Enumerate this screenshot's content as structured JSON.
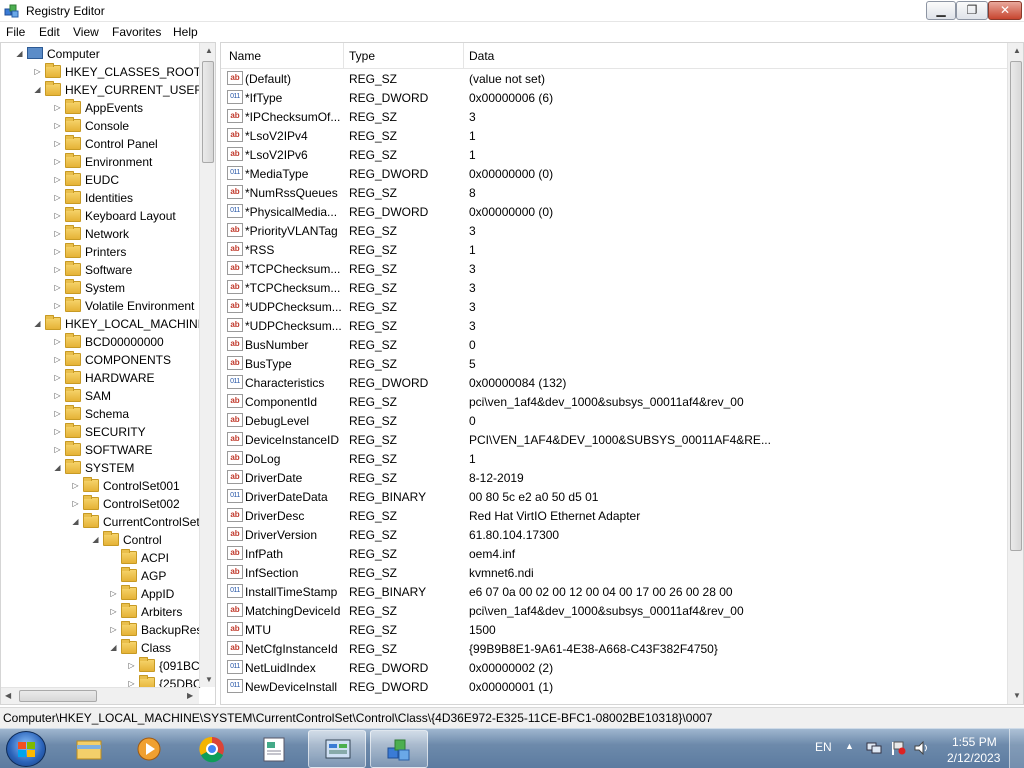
{
  "window": {
    "title": "Registry Editor",
    "min_label": "▁",
    "max_label": "❐",
    "close_label": "✕"
  },
  "menu": [
    "File",
    "Edit",
    "View",
    "Favorites",
    "Help"
  ],
  "tree": [
    {
      "label": "Computer",
      "level": 0,
      "state": "open",
      "icon": "computer-icon"
    },
    {
      "label": "HKEY_CLASSES_ROOT",
      "level": 1,
      "state": "closed"
    },
    {
      "label": "HKEY_CURRENT_USER",
      "level": 1,
      "state": "open"
    },
    {
      "label": "AppEvents",
      "level": 2,
      "state": "closed"
    },
    {
      "label": "Console",
      "level": 2,
      "state": "closed"
    },
    {
      "label": "Control Panel",
      "level": 2,
      "state": "closed"
    },
    {
      "label": "Environment",
      "level": 2,
      "state": "closed"
    },
    {
      "label": "EUDC",
      "level": 2,
      "state": "closed"
    },
    {
      "label": "Identities",
      "level": 2,
      "state": "closed"
    },
    {
      "label": "Keyboard Layout",
      "level": 2,
      "state": "closed"
    },
    {
      "label": "Network",
      "level": 2,
      "state": "closed"
    },
    {
      "label": "Printers",
      "level": 2,
      "state": "closed"
    },
    {
      "label": "Software",
      "level": 2,
      "state": "closed"
    },
    {
      "label": "System",
      "level": 2,
      "state": "closed"
    },
    {
      "label": "Volatile Environment",
      "level": 2,
      "state": "closed"
    },
    {
      "label": "HKEY_LOCAL_MACHINE",
      "level": 1,
      "state": "open"
    },
    {
      "label": "BCD00000000",
      "level": 2,
      "state": "closed"
    },
    {
      "label": "COMPONENTS",
      "level": 2,
      "state": "closed"
    },
    {
      "label": "HARDWARE",
      "level": 2,
      "state": "closed"
    },
    {
      "label": "SAM",
      "level": 2,
      "state": "closed"
    },
    {
      "label": "Schema",
      "level": 2,
      "state": "closed"
    },
    {
      "label": "SECURITY",
      "level": 2,
      "state": "closed"
    },
    {
      "label": "SOFTWARE",
      "level": 2,
      "state": "closed"
    },
    {
      "label": "SYSTEM",
      "level": 2,
      "state": "open"
    },
    {
      "label": "ControlSet001",
      "level": 3,
      "state": "closed"
    },
    {
      "label": "ControlSet002",
      "level": 3,
      "state": "closed"
    },
    {
      "label": "CurrentControlSet",
      "level": 3,
      "state": "open"
    },
    {
      "label": "Control",
      "level": 4,
      "state": "open"
    },
    {
      "label": "ACPI",
      "level": 5,
      "state": "none"
    },
    {
      "label": "AGP",
      "level": 5,
      "state": "none"
    },
    {
      "label": "AppID",
      "level": 5,
      "state": "closed"
    },
    {
      "label": "Arbiters",
      "level": 5,
      "state": "closed"
    },
    {
      "label": "BackupRes",
      "level": 5,
      "state": "closed"
    },
    {
      "label": "Class",
      "level": 5,
      "state": "open"
    },
    {
      "label": "{091BC",
      "level": 6,
      "state": "closed"
    },
    {
      "label": "{25DBC",
      "level": 6,
      "state": "closed"
    }
  ],
  "columns": {
    "name": "Name",
    "type": "Type",
    "data": "Data"
  },
  "values": [
    {
      "icon": "ab",
      "name": "(Default)",
      "type": "REG_SZ",
      "data": "(value not set)"
    },
    {
      "icon": "bin",
      "name": "*IfType",
      "type": "REG_DWORD",
      "data": "0x00000006 (6)"
    },
    {
      "icon": "ab",
      "name": "*IPChecksumOf...",
      "type": "REG_SZ",
      "data": "3"
    },
    {
      "icon": "ab",
      "name": "*LsoV2IPv4",
      "type": "REG_SZ",
      "data": "1"
    },
    {
      "icon": "ab",
      "name": "*LsoV2IPv6",
      "type": "REG_SZ",
      "data": "1"
    },
    {
      "icon": "bin",
      "name": "*MediaType",
      "type": "REG_DWORD",
      "data": "0x00000000 (0)"
    },
    {
      "icon": "ab",
      "name": "*NumRssQueues",
      "type": "REG_SZ",
      "data": "8"
    },
    {
      "icon": "bin",
      "name": "*PhysicalMedia...",
      "type": "REG_DWORD",
      "data": "0x00000000 (0)"
    },
    {
      "icon": "ab",
      "name": "*PriorityVLANTag",
      "type": "REG_SZ",
      "data": "3"
    },
    {
      "icon": "ab",
      "name": "*RSS",
      "type": "REG_SZ",
      "data": "1"
    },
    {
      "icon": "ab",
      "name": "*TCPChecksum...",
      "type": "REG_SZ",
      "data": "3"
    },
    {
      "icon": "ab",
      "name": "*TCPChecksum...",
      "type": "REG_SZ",
      "data": "3"
    },
    {
      "icon": "ab",
      "name": "*UDPChecksum...",
      "type": "REG_SZ",
      "data": "3"
    },
    {
      "icon": "ab",
      "name": "*UDPChecksum...",
      "type": "REG_SZ",
      "data": "3"
    },
    {
      "icon": "ab",
      "name": "BusNumber",
      "type": "REG_SZ",
      "data": "0"
    },
    {
      "icon": "ab",
      "name": "BusType",
      "type": "REG_SZ",
      "data": "5"
    },
    {
      "icon": "bin",
      "name": "Characteristics",
      "type": "REG_DWORD",
      "data": "0x00000084 (132)"
    },
    {
      "icon": "ab",
      "name": "ComponentId",
      "type": "REG_SZ",
      "data": "pci\\ven_1af4&dev_1000&subsys_00011af4&rev_00"
    },
    {
      "icon": "ab",
      "name": "DebugLevel",
      "type": "REG_SZ",
      "data": "0"
    },
    {
      "icon": "ab",
      "name": "DeviceInstanceID",
      "type": "REG_SZ",
      "data": "PCI\\VEN_1AF4&DEV_1000&SUBSYS_00011AF4&RE..."
    },
    {
      "icon": "ab",
      "name": "DoLog",
      "type": "REG_SZ",
      "data": "1"
    },
    {
      "icon": "ab",
      "name": "DriverDate",
      "type": "REG_SZ",
      "data": "8-12-2019"
    },
    {
      "icon": "bin",
      "name": "DriverDateData",
      "type": "REG_BINARY",
      "data": "00 80 5c e2 a0 50 d5 01"
    },
    {
      "icon": "ab",
      "name": "DriverDesc",
      "type": "REG_SZ",
      "data": "Red Hat VirtIO Ethernet Adapter"
    },
    {
      "icon": "ab",
      "name": "DriverVersion",
      "type": "REG_SZ",
      "data": "61.80.104.17300"
    },
    {
      "icon": "ab",
      "name": "InfPath",
      "type": "REG_SZ",
      "data": "oem4.inf"
    },
    {
      "icon": "ab",
      "name": "InfSection",
      "type": "REG_SZ",
      "data": "kvmnet6.ndi"
    },
    {
      "icon": "bin",
      "name": "InstallTimeStamp",
      "type": "REG_BINARY",
      "data": "e6 07 0a 00 02 00 12 00 04 00 17 00 26 00 28 00"
    },
    {
      "icon": "ab",
      "name": "MatchingDeviceId",
      "type": "REG_SZ",
      "data": "pci\\ven_1af4&dev_1000&subsys_00011af4&rev_00"
    },
    {
      "icon": "ab",
      "name": "MTU",
      "type": "REG_SZ",
      "data": "1500"
    },
    {
      "icon": "ab",
      "name": "NetCfgInstanceId",
      "type": "REG_SZ",
      "data": "{99B9B8E1-9A61-4E38-A668-C43F382F4750}"
    },
    {
      "icon": "bin",
      "name": "NetLuidIndex",
      "type": "REG_DWORD",
      "data": "0x00000002 (2)"
    },
    {
      "icon": "bin",
      "name": "NewDeviceInstall",
      "type": "REG_DWORD",
      "data": "0x00000001 (1)"
    }
  ],
  "statusbar": "Computer\\HKEY_LOCAL_MACHINE\\SYSTEM\\CurrentControlSet\\Control\\Class\\{4D36E972-E325-11CE-BFC1-08002BE10318}\\0007",
  "taskbar": {
    "buttons": [
      {
        "name": "explorer-icon",
        "active": false
      },
      {
        "name": "media-player-icon",
        "active": false
      },
      {
        "name": "chrome-icon",
        "active": false
      },
      {
        "name": "document-icon",
        "active": false
      },
      {
        "name": "control-panel-icon",
        "active": true
      },
      {
        "name": "registry-editor-icon",
        "active": true
      }
    ],
    "lang": "EN",
    "time": "1:55 PM",
    "date": "2/12/2023"
  }
}
